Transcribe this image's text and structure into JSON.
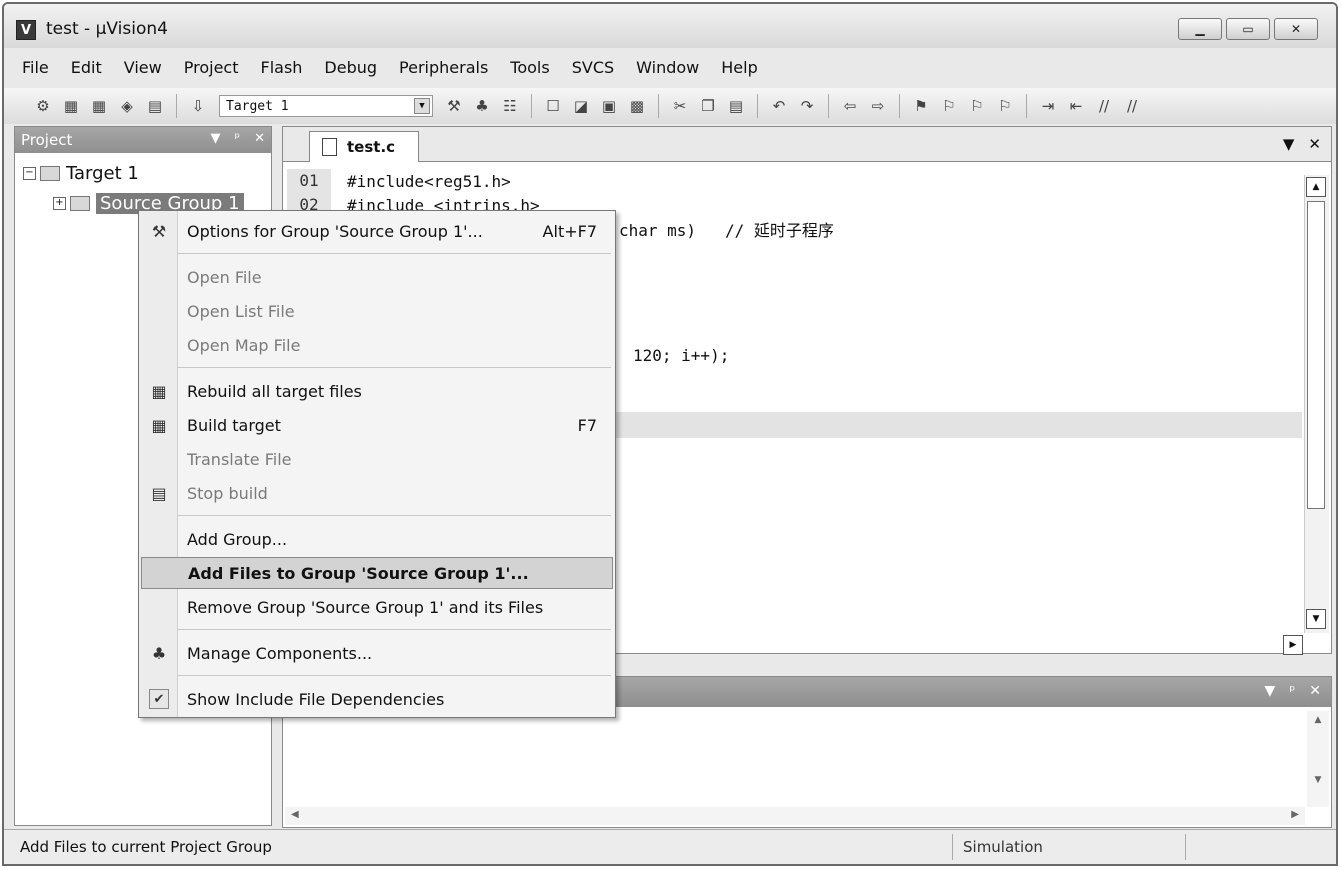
{
  "window": {
    "title": "test  - µVision4",
    "app_icon": "V"
  },
  "menubar": [
    "File",
    "Edit",
    "View",
    "Project",
    "Flash",
    "Debug",
    "Peripherals",
    "Tools",
    "SVCS",
    "Window",
    "Help"
  ],
  "toolbar": {
    "target": "Target 1"
  },
  "project_panel": {
    "title": "Project",
    "target": "Target 1",
    "group": "Source Group 1"
  },
  "editor": {
    "tab": "test.c",
    "lines": [
      {
        "num": "01",
        "code": "#include<reg51.h>"
      },
      {
        "num": "02",
        "code": "#include <intrins.h>"
      }
    ],
    "partial_line_1": "char ms)   // 延时子程序",
    "partial_line_2": "120; i++);"
  },
  "context_menu": {
    "items": [
      {
        "label": "Options for Group 'Source Group 1'...",
        "shortcut": "Alt+F7"
      },
      {
        "label": "Open File"
      },
      {
        "label": "Open List File"
      },
      {
        "label": "Open Map File"
      },
      {
        "label": "Rebuild all target files"
      },
      {
        "label": "Build target",
        "shortcut": "F7"
      },
      {
        "label": "Translate File"
      },
      {
        "label": "Stop build"
      },
      {
        "label": "Add Group..."
      },
      {
        "label": "Add Files to Group 'Source Group 1'..."
      },
      {
        "label": "Remove Group 'Source Group 1' and its Files"
      },
      {
        "label": "Manage Components..."
      },
      {
        "label": "Show Include File Dependencies"
      }
    ]
  },
  "statusbar": {
    "message": "Add Files to current Project Group",
    "mode": "Simulation"
  }
}
